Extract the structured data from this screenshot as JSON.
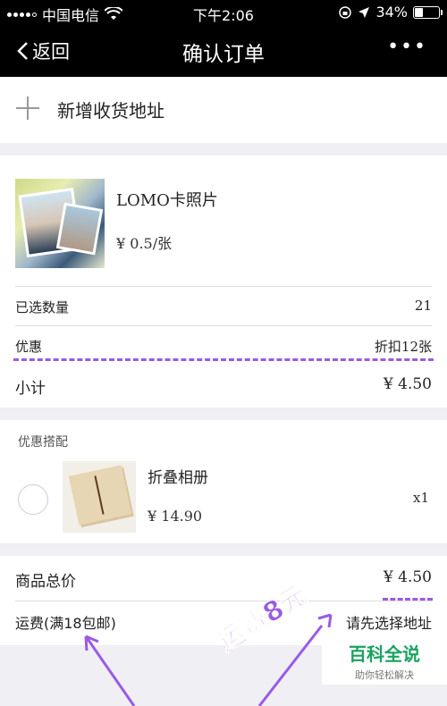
{
  "statusbar": {
    "carrier": "中国电信",
    "time": "下午2:06",
    "battery": "34%",
    "battery_level": 0.34,
    "icons": [
      "signal-dots-icon",
      "wifi-icon",
      "lock-rotation-icon",
      "location-arrow-icon",
      "battery-icon"
    ]
  },
  "navbar": {
    "back_label": "返回",
    "title": "确认订单",
    "more_label": "•••"
  },
  "address": {
    "add_label": "新增收货地址"
  },
  "product": {
    "name": "LOMO卡照片",
    "price": "¥ 0.5/张",
    "quantity_label": "已选数量",
    "quantity_value": "21",
    "discount_label": "优惠",
    "discount_value": "折扣12张",
    "subtotal_label": "小计",
    "subtotal_value": "¥ 4.50"
  },
  "combo": {
    "heading": "优惠搭配",
    "name": "折叠相册",
    "price": "¥ 14.90",
    "qty": "x1"
  },
  "totals": {
    "total_label": "商品总价",
    "total_value": "¥ 4.50",
    "shipping_label": "运费(满18包邮)",
    "shipping_value": "请先选择地址"
  },
  "annotation": {
    "text": "运费8元",
    "color": "#9a5ae6"
  },
  "watermark": {
    "title": "百科全说",
    "subtitle": "助你轻松解决",
    "color": "#1aa260"
  }
}
